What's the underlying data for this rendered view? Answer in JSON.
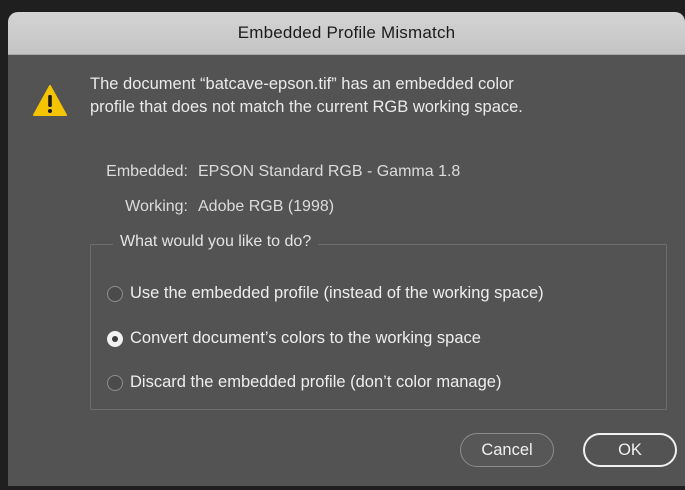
{
  "dialog": {
    "title": "Embedded Profile Mismatch",
    "icon": "warning-triangle-icon",
    "message_line1": "The document “batcave-epson.tif” has an embedded color",
    "message_line2": "profile that does not match the current RGB working space.",
    "embedded_label": "Embedded:",
    "embedded_value": "EPSON  Standard RGB - Gamma 1.8",
    "working_label": "Working:",
    "working_value": "Adobe RGB (1998)"
  },
  "options": {
    "legend": "What would you like to do?",
    "items": [
      {
        "label": "Use the embedded profile (instead of the working space)",
        "checked": false
      },
      {
        "label": "Convert document’s colors to the working space",
        "checked": true
      },
      {
        "label": "Discard the embedded profile (don’t color manage)",
        "checked": false
      }
    ]
  },
  "buttons": {
    "cancel": "Cancel",
    "ok": "OK"
  },
  "colors": {
    "dialog_bg": "#535353",
    "titlebar_bg": "#cccccc",
    "warning_yellow": "#f5c400"
  }
}
